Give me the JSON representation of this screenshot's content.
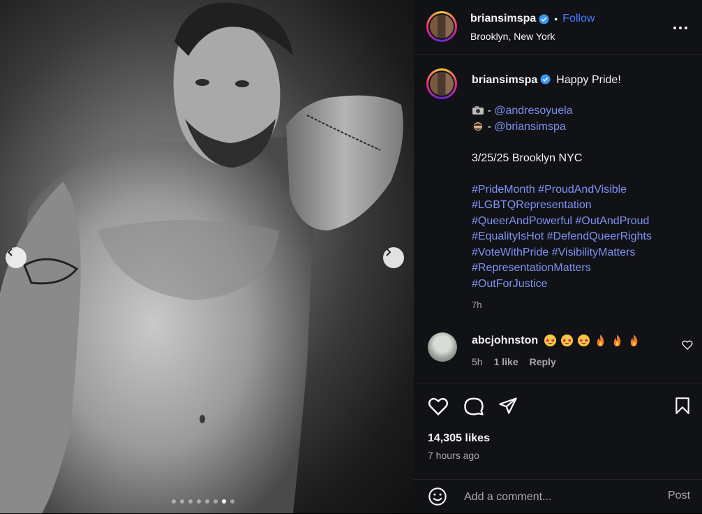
{
  "post": {
    "username": "briansimspa",
    "follow_label": "Follow",
    "location": "Brooklyn, New York",
    "caption": {
      "text": "Happy Pride!",
      "credit1_handle": "@andresoyuela",
      "credit2_handle": "@briansimspa",
      "date_line": "3/25/25 Brooklyn NYC",
      "hashtag_lines": [
        "#PrideMonth #ProudAndVisible",
        "#LGBTQRepresentation",
        "#QueerAndPowerful #OutAndProud",
        "#EqualityIsHot #DefendQueerRights",
        "#VoteWithPride #VisibilityMatters",
        "#RepresentationMatters",
        "#OutForJustice"
      ],
      "time": "7h"
    },
    "carousel": {
      "dots": 8,
      "active_index": 6
    },
    "comment": {
      "username": "abcjohnston",
      "time": "5h",
      "likes": "1 like",
      "reply_label": "Reply"
    },
    "likes": "14,305 likes",
    "posted": "7 hours ago",
    "add_comment": {
      "placeholder": "Add a comment...",
      "post_label": "Post"
    }
  },
  "colors": {
    "link": "#7c93f3",
    "follow": "#4a7dff",
    "verified": "#3897f0",
    "panel_bg": "#111216"
  }
}
